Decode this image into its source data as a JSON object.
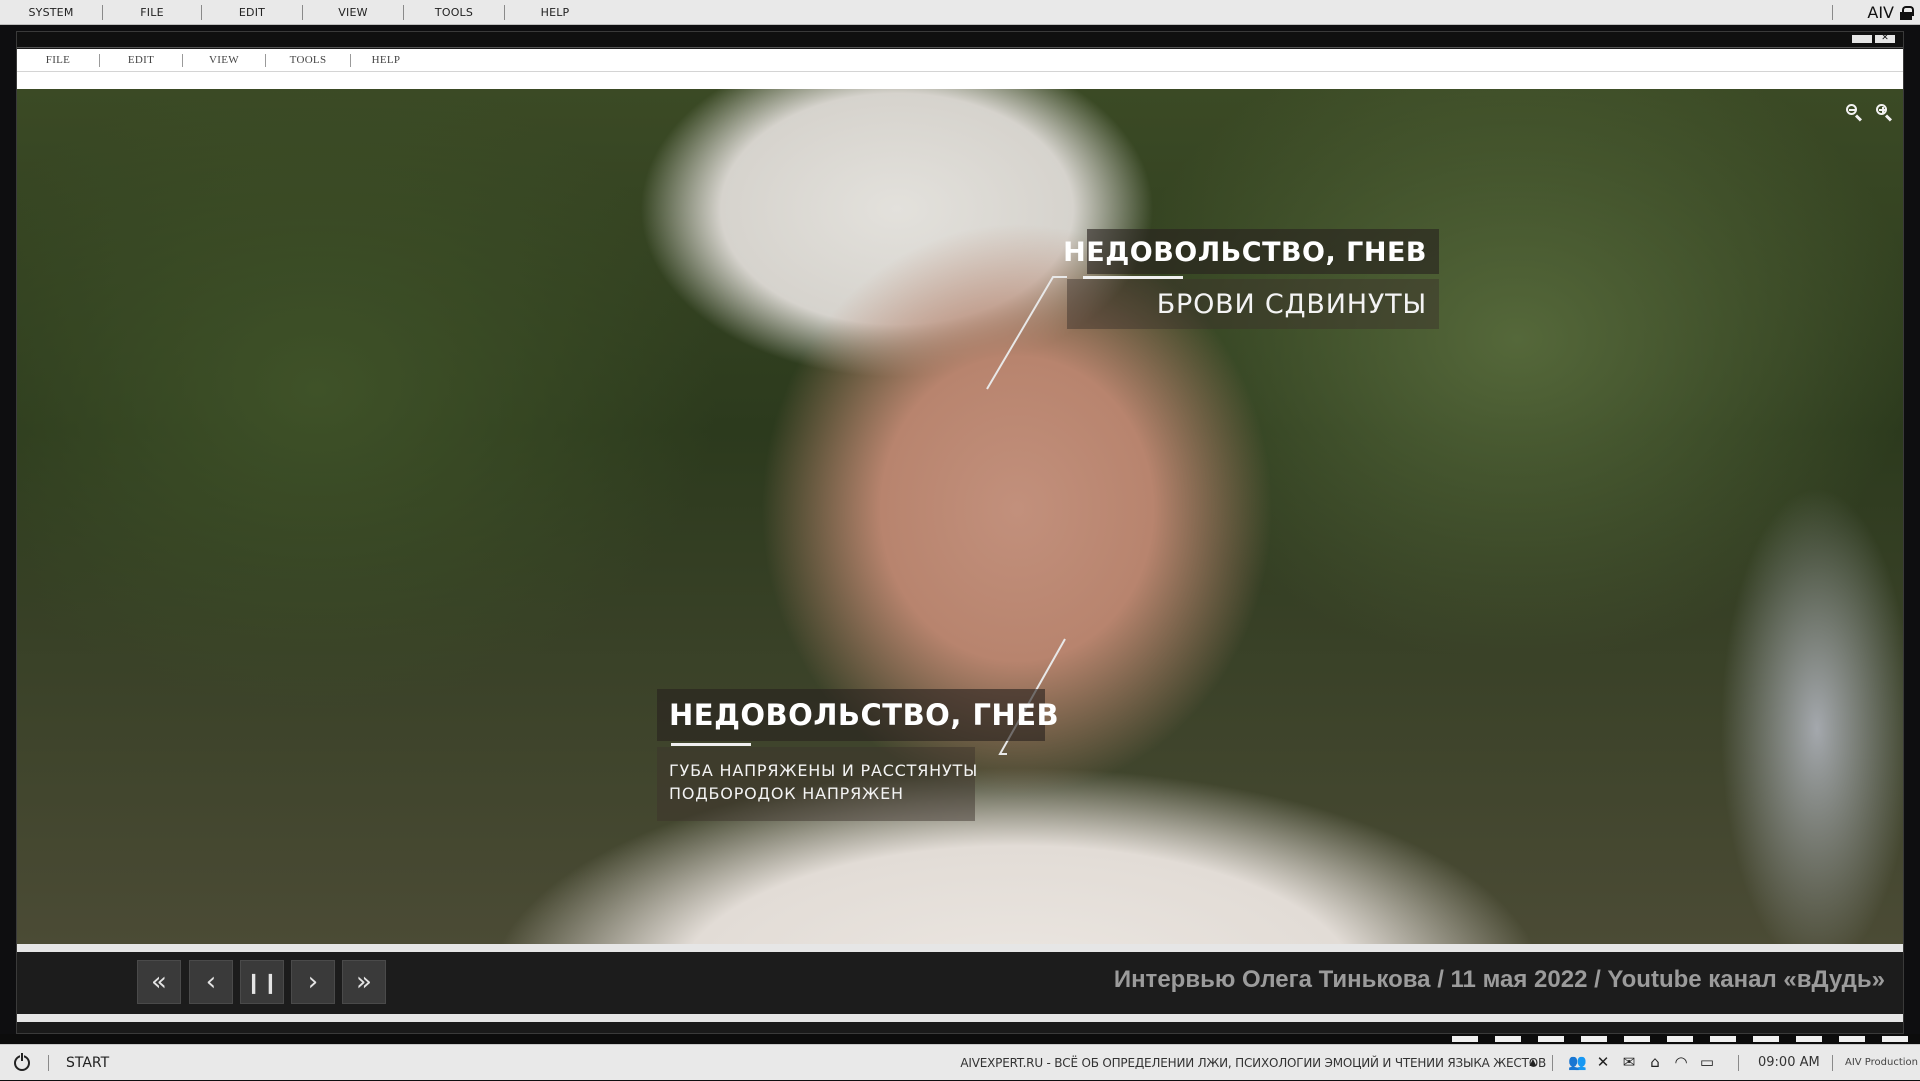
{
  "system_menu": {
    "items": [
      "SYSTEM",
      "FILE",
      "EDIT",
      "VIEW",
      "TOOLS",
      "HELP"
    ],
    "brand": "AIV"
  },
  "app_menu": {
    "items": [
      "FILE",
      "EDIT",
      "VIEW",
      "TOOLS",
      "HELP"
    ]
  },
  "video": {
    "callout_top": {
      "title": "НЕДОВОЛЬСТВО, ГНЕВ",
      "detail": "БРОВИ СДВИНУТЫ"
    },
    "callout_bottom": {
      "title": "НЕДОВОЛЬСТВО, ГНЕВ",
      "detail_line1": "ГУБА НАПРЯЖЕНЫ И РАССТЯНУТЫ",
      "detail_line2": "ПОДБОРОДОК НАПРЯЖЕН"
    },
    "zoom_icons": [
      "zoom-out-icon",
      "zoom-in-icon"
    ]
  },
  "controls": {
    "buttons": [
      {
        "icon": "fast-backward-icon",
        "glyph": "«"
      },
      {
        "icon": "step-back-icon",
        "glyph": "‹"
      },
      {
        "icon": "pause-icon",
        "glyph": "❙❙"
      },
      {
        "icon": "step-forward-icon",
        "glyph": "›"
      },
      {
        "icon": "fast-forward-icon",
        "glyph": "»"
      }
    ],
    "caption": "Интервью Олега Тинькова  / 11 мая 2022 / Youtube канал «вДудь»"
  },
  "taskbar": {
    "start_label": "START",
    "ticker": "AIVEXPERT.RU - ВСЁ ОБ ОПРЕДЕЛЕНИИ ЛЖИ, ПСИХОЛОГИИ ЭМОЦИЙ И ЧТЕНИИ ЯЗЫКА ЖЕСТОВ",
    "chevron": "▲",
    "tray_icons": [
      "users-icon",
      "network-off-icon",
      "mail-icon",
      "home-icon",
      "wifi-icon",
      "monitor-icon"
    ],
    "tray_glyphs": [
      "👥",
      "✕",
      "✉",
      "⌂",
      "◠",
      "▭"
    ],
    "clock": "09:00 AM",
    "production": "AIV Production"
  },
  "colors": {
    "menu_bg": "#e9e9e9",
    "window_bg": "#1a1a1a",
    "control_btn_bg": "#3a3a3a",
    "caption_color": "#9b9b9b"
  }
}
